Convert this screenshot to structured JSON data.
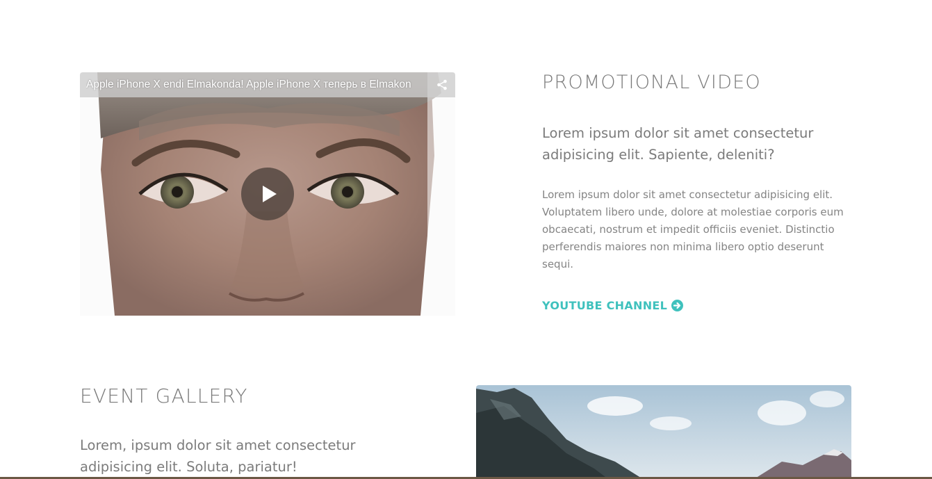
{
  "promo": {
    "video": {
      "title": "Apple iPhone X endi Elmakonda! Apple iPhone X теперь в Elmakon",
      "share_icon": "share-icon",
      "play_icon": "play-icon"
    },
    "heading": "PROMOTIONAL VIDEO",
    "lead": "Lorem ipsum dolor sit amet consectetur adipisicing elit. Sapiente, deleniti?",
    "body": "Lorem ipsum dolor sit amet consectetur adipisicing elit. Voluptatem libero unde, dolore at molestiae corporis eum obcaecati, nostrum et impedit officiis eveniet. Distinctio perferendis maiores non minima libero optio deserunt sequi.",
    "link_label": "YOUTUBE CHANNEL",
    "link_icon": "arrow-circle-right-icon"
  },
  "gallery": {
    "heading": "EVENT GALLERY",
    "lead": "Lorem, ipsum dolor sit amet consectetur adipisicing elit. Soluta, pariatur!"
  },
  "colors": {
    "accent": "#3fc1bd",
    "heading": "#7a7a7a",
    "text": "#848484"
  }
}
